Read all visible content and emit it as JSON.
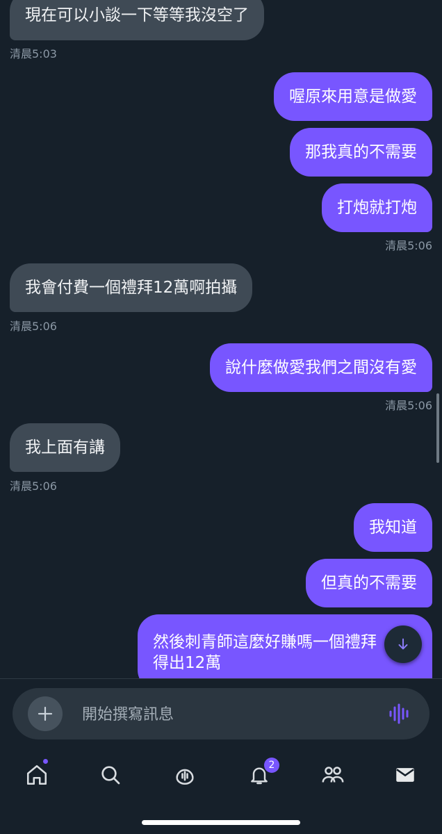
{
  "messages": [
    {
      "dir": "in",
      "text": "現在可以小談一下等等我沒空了"
    },
    {
      "dir": "in",
      "time": "清晨5:03"
    },
    {
      "dir": "out",
      "text": "喔原來用意是做愛"
    },
    {
      "dir": "out",
      "text": "那我真的不需要"
    },
    {
      "dir": "out",
      "text": "打炮就打炮"
    },
    {
      "dir": "out",
      "time": "清晨5:06"
    },
    {
      "dir": "in",
      "text": "我會付費一個禮拜12萬啊拍攝"
    },
    {
      "dir": "in",
      "time": "清晨5:06"
    },
    {
      "dir": "out",
      "text": "說什麼做愛我們之間沒有愛"
    },
    {
      "dir": "out",
      "time": "清晨5:06"
    },
    {
      "dir": "in",
      "text": "我上面有講"
    },
    {
      "dir": "in",
      "time": "清晨5:06"
    },
    {
      "dir": "out",
      "text": "我知道"
    },
    {
      "dir": "out",
      "text": "但真的不需要"
    },
    {
      "dir": "out",
      "line1": "然後刺青師這麼好賺嗎一個禮拜",
      "line2": "得出12萬"
    }
  ],
  "composer": {
    "placeholder": "開始撰寫訊息"
  },
  "tabbar": {
    "items": [
      "home",
      "search",
      "spaces",
      "notifications",
      "communities",
      "messages"
    ],
    "notifications_badge": "2"
  },
  "colors": {
    "background": "#16202a",
    "outgoing_bubble": "#7856ff",
    "incoming_bubble": "#3f4a55"
  }
}
